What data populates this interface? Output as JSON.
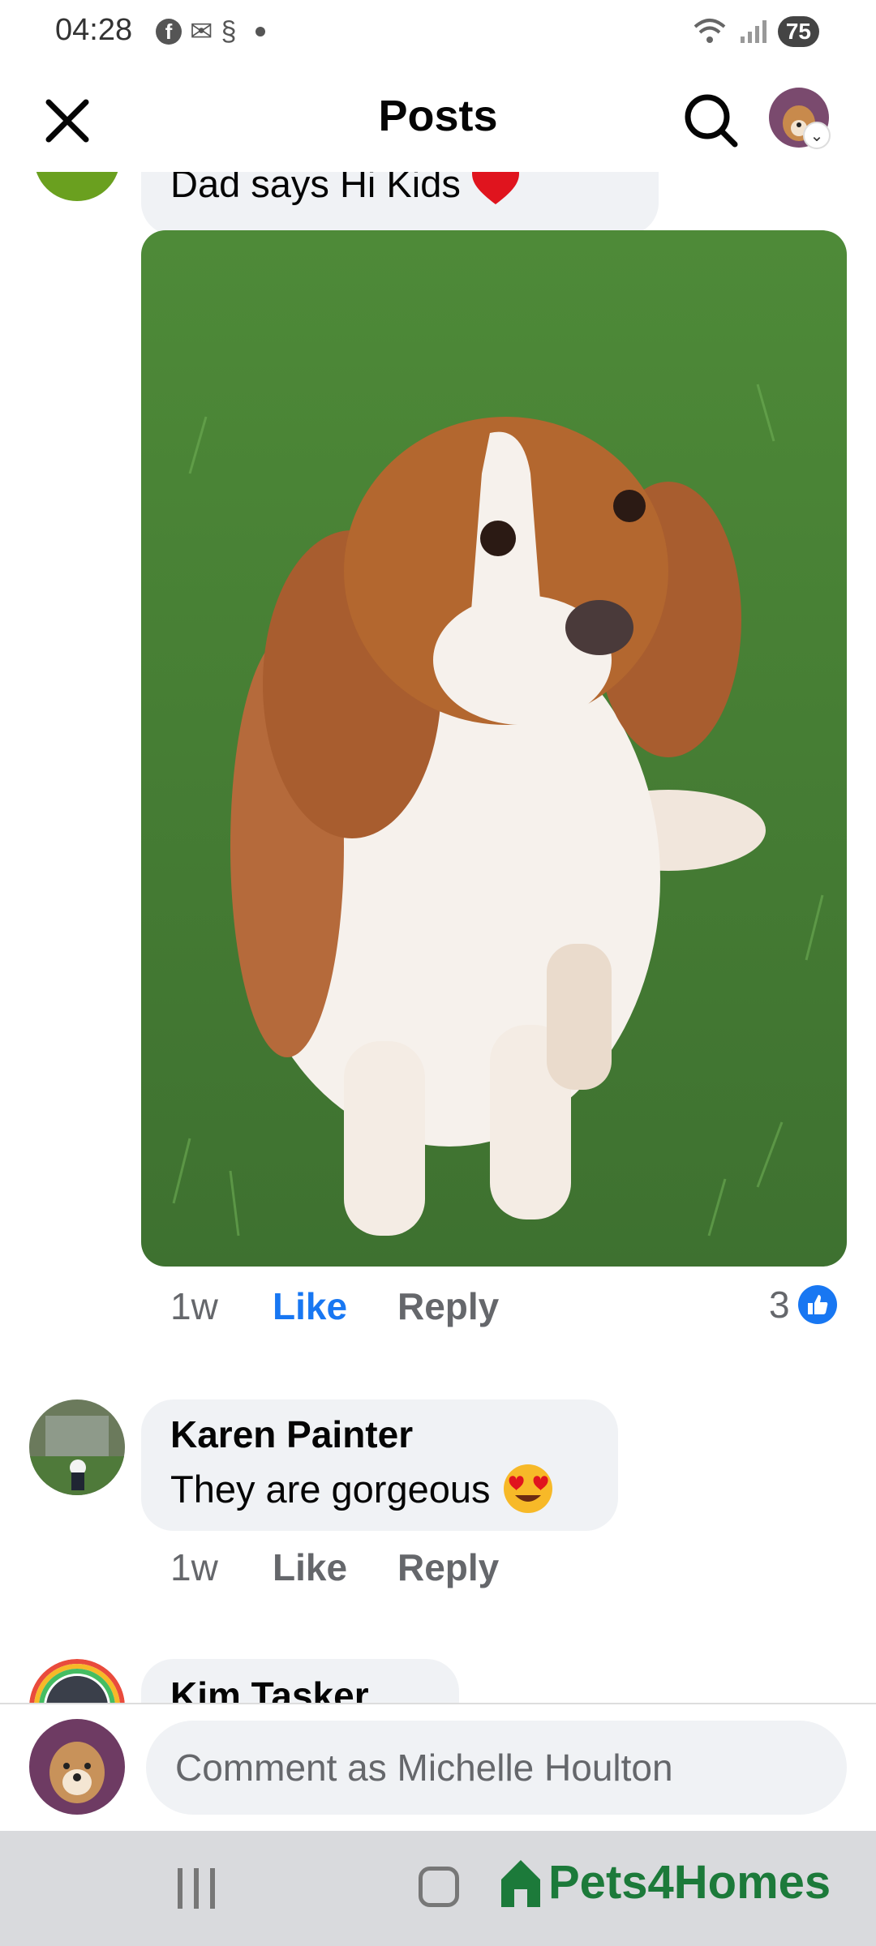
{
  "status_bar": {
    "time": "04:28",
    "app_icons": [
      "facebook-icon",
      "gmail-icon",
      "s-icon"
    ],
    "battery": "75"
  },
  "header": {
    "title": "Posts"
  },
  "comments": [
    {
      "text": "Dad says Hi Kids",
      "emoji": "heart-icon",
      "time": "1w",
      "like_label": "Like",
      "reply_label": "Reply",
      "reaction_count": "3",
      "reaction_icon": "thumbs-up-icon"
    },
    {
      "author": "Karen Painter",
      "text": "They are gorgeous",
      "emoji": "heart-eyes-emoji",
      "time": "1w",
      "like_label": "Like",
      "reply_label": "Reply"
    },
    {
      "author": "Kim Tasker"
    }
  ],
  "composer": {
    "placeholder": "Comment as Michelle Houlton"
  },
  "watermark": {
    "text": "Pets4Homes"
  },
  "colors": {
    "accent": "#1877f2",
    "bubble": "#f0f2f5",
    "muted_text": "#65676b",
    "watermark": "#1c7a3a"
  }
}
